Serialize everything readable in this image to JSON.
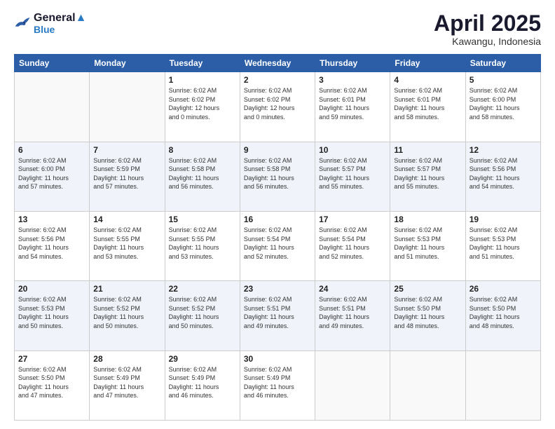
{
  "header": {
    "logo_line1": "General",
    "logo_line2": "Blue",
    "month": "April 2025",
    "location": "Kawangu, Indonesia"
  },
  "weekdays": [
    "Sunday",
    "Monday",
    "Tuesday",
    "Wednesday",
    "Thursday",
    "Friday",
    "Saturday"
  ],
  "weeks": [
    [
      {
        "day": "",
        "info": ""
      },
      {
        "day": "",
        "info": ""
      },
      {
        "day": "1",
        "info": "Sunrise: 6:02 AM\nSunset: 6:02 PM\nDaylight: 12 hours\nand 0 minutes."
      },
      {
        "day": "2",
        "info": "Sunrise: 6:02 AM\nSunset: 6:02 PM\nDaylight: 12 hours\nand 0 minutes."
      },
      {
        "day": "3",
        "info": "Sunrise: 6:02 AM\nSunset: 6:01 PM\nDaylight: 11 hours\nand 59 minutes."
      },
      {
        "day": "4",
        "info": "Sunrise: 6:02 AM\nSunset: 6:01 PM\nDaylight: 11 hours\nand 58 minutes."
      },
      {
        "day": "5",
        "info": "Sunrise: 6:02 AM\nSunset: 6:00 PM\nDaylight: 11 hours\nand 58 minutes."
      }
    ],
    [
      {
        "day": "6",
        "info": "Sunrise: 6:02 AM\nSunset: 6:00 PM\nDaylight: 11 hours\nand 57 minutes."
      },
      {
        "day": "7",
        "info": "Sunrise: 6:02 AM\nSunset: 5:59 PM\nDaylight: 11 hours\nand 57 minutes."
      },
      {
        "day": "8",
        "info": "Sunrise: 6:02 AM\nSunset: 5:58 PM\nDaylight: 11 hours\nand 56 minutes."
      },
      {
        "day": "9",
        "info": "Sunrise: 6:02 AM\nSunset: 5:58 PM\nDaylight: 11 hours\nand 56 minutes."
      },
      {
        "day": "10",
        "info": "Sunrise: 6:02 AM\nSunset: 5:57 PM\nDaylight: 11 hours\nand 55 minutes."
      },
      {
        "day": "11",
        "info": "Sunrise: 6:02 AM\nSunset: 5:57 PM\nDaylight: 11 hours\nand 55 minutes."
      },
      {
        "day": "12",
        "info": "Sunrise: 6:02 AM\nSunset: 5:56 PM\nDaylight: 11 hours\nand 54 minutes."
      }
    ],
    [
      {
        "day": "13",
        "info": "Sunrise: 6:02 AM\nSunset: 5:56 PM\nDaylight: 11 hours\nand 54 minutes."
      },
      {
        "day": "14",
        "info": "Sunrise: 6:02 AM\nSunset: 5:55 PM\nDaylight: 11 hours\nand 53 minutes."
      },
      {
        "day": "15",
        "info": "Sunrise: 6:02 AM\nSunset: 5:55 PM\nDaylight: 11 hours\nand 53 minutes."
      },
      {
        "day": "16",
        "info": "Sunrise: 6:02 AM\nSunset: 5:54 PM\nDaylight: 11 hours\nand 52 minutes."
      },
      {
        "day": "17",
        "info": "Sunrise: 6:02 AM\nSunset: 5:54 PM\nDaylight: 11 hours\nand 52 minutes."
      },
      {
        "day": "18",
        "info": "Sunrise: 6:02 AM\nSunset: 5:53 PM\nDaylight: 11 hours\nand 51 minutes."
      },
      {
        "day": "19",
        "info": "Sunrise: 6:02 AM\nSunset: 5:53 PM\nDaylight: 11 hours\nand 51 minutes."
      }
    ],
    [
      {
        "day": "20",
        "info": "Sunrise: 6:02 AM\nSunset: 5:53 PM\nDaylight: 11 hours\nand 50 minutes."
      },
      {
        "day": "21",
        "info": "Sunrise: 6:02 AM\nSunset: 5:52 PM\nDaylight: 11 hours\nand 50 minutes."
      },
      {
        "day": "22",
        "info": "Sunrise: 6:02 AM\nSunset: 5:52 PM\nDaylight: 11 hours\nand 50 minutes."
      },
      {
        "day": "23",
        "info": "Sunrise: 6:02 AM\nSunset: 5:51 PM\nDaylight: 11 hours\nand 49 minutes."
      },
      {
        "day": "24",
        "info": "Sunrise: 6:02 AM\nSunset: 5:51 PM\nDaylight: 11 hours\nand 49 minutes."
      },
      {
        "day": "25",
        "info": "Sunrise: 6:02 AM\nSunset: 5:50 PM\nDaylight: 11 hours\nand 48 minutes."
      },
      {
        "day": "26",
        "info": "Sunrise: 6:02 AM\nSunset: 5:50 PM\nDaylight: 11 hours\nand 48 minutes."
      }
    ],
    [
      {
        "day": "27",
        "info": "Sunrise: 6:02 AM\nSunset: 5:50 PM\nDaylight: 11 hours\nand 47 minutes."
      },
      {
        "day": "28",
        "info": "Sunrise: 6:02 AM\nSunset: 5:49 PM\nDaylight: 11 hours\nand 47 minutes."
      },
      {
        "day": "29",
        "info": "Sunrise: 6:02 AM\nSunset: 5:49 PM\nDaylight: 11 hours\nand 46 minutes."
      },
      {
        "day": "30",
        "info": "Sunrise: 6:02 AM\nSunset: 5:49 PM\nDaylight: 11 hours\nand 46 minutes."
      },
      {
        "day": "",
        "info": ""
      },
      {
        "day": "",
        "info": ""
      },
      {
        "day": "",
        "info": ""
      }
    ]
  ]
}
